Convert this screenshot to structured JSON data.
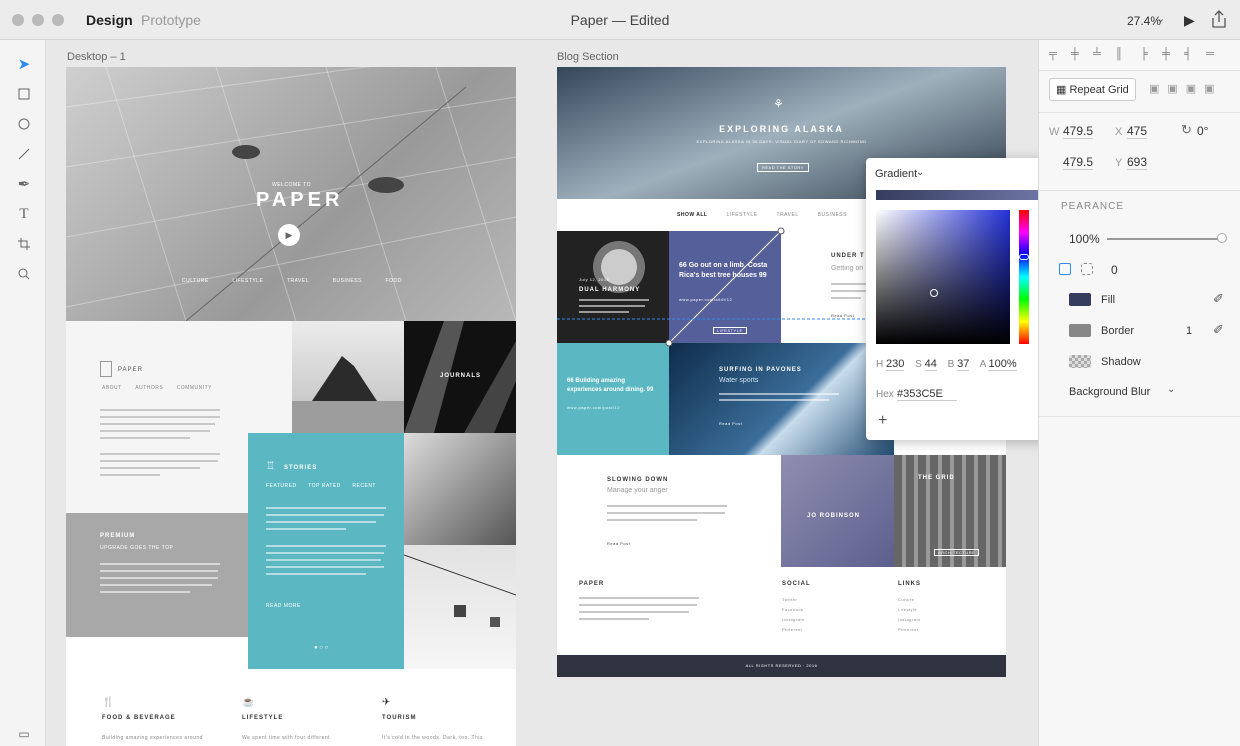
{
  "titlebar": {
    "tab_design": "Design",
    "tab_prototype": "Prototype",
    "doc_title": "Paper — Edited",
    "zoom": "27.4%"
  },
  "artboards": {
    "left": "Desktop – 1",
    "right": "Blog Section"
  },
  "left_art": {
    "hero_small": "WELCOME TO",
    "hero_title": "PAPER",
    "nav": [
      "CULTURE",
      "LIFESTYLE",
      "TRAVEL",
      "BUSINESS",
      "FOOD"
    ],
    "paper_label": "PAPER",
    "paper_tabs": [
      "ABOUT",
      "AUTHORS",
      "COMMUNITY"
    ],
    "journals": "JOURNALS",
    "stories": "STORIES",
    "stories_tabs": [
      "FEATURED",
      "TOP RATED",
      "RECENT"
    ],
    "premium": "PREMIUM",
    "premium_sub": "UPGRADE GOES THE TOP",
    "read_more": "READ MORE",
    "food": "FOOD & BEVERAGE",
    "food_text": "Building amazing experiences around",
    "lifestyle": "LIFESTYLE",
    "lifestyle_text": "We spent time with four different",
    "tourism": "TOURISM",
    "tourism_text": "It's cold in the woods. Dark, too. This"
  },
  "right_art": {
    "hero_title": "EXPLORING ALASKA",
    "hero_sub": "EXPLORING ALASKA IN 30 DAYS: VISUAL DIARY OF EDWARD RICHMOND",
    "hero_btn": "READ THE STORY",
    "filters": [
      "SHOW ALL",
      "LIFESTYLE",
      "TRAVEL",
      "BUSINESS"
    ],
    "dual": "DUAL HARMONY",
    "dual_date": "July 12, 2016",
    "quote1": "66 Go out on a limb. Costa Rica's best tree houses 99",
    "quote1_link": "www.paper.com/a94f/12",
    "under_title": "UNDER T",
    "under_sub": "Getting on",
    "read_post": "Read Post",
    "quote2": "66 Building amazing experiences around dining. 99",
    "quote2_link": "www.paper.com/post/12",
    "surfing": "SURFING IN PAVONES",
    "surfing_sub": "Water sports",
    "slowing": "SLOWING DOWN",
    "slowing_sub": "Manage your anger",
    "jo": "JO ROBINSON",
    "grid": "THE GRID",
    "architecture": "ARCHITECTURE",
    "lifestyle_tag": "LIFESTYLE",
    "footer_paper": "PAPER",
    "footer_social": "SOCIAL",
    "footer_links": "LINKS",
    "social": [
      "Twitter",
      "Facebook",
      "Instagram",
      "Pinterest"
    ],
    "links": [
      "Culture",
      "Lifestyle",
      "Instagram",
      "Pinterest"
    ],
    "copyright": "ALL RIGHTS RESERVED · 2016"
  },
  "picker": {
    "mode": "Gradient",
    "h_label": "H",
    "h": "230",
    "s_label": "S",
    "s": "44",
    "b_label": "B",
    "b": "37",
    "a_label": "A",
    "a": "100%",
    "hex_label": "Hex",
    "hex": "#353C5E",
    "color": "#353C5E"
  },
  "panel": {
    "repeat_grid": "Repeat Grid",
    "w_label": "W",
    "w": "479.5",
    "x_label": "X",
    "x": "475",
    "rotation": "0°",
    "h": "479.5",
    "y_label": "Y",
    "y": "693",
    "appearance": "PEARANCE",
    "opacity": "100%",
    "radius": "0",
    "fill": "Fill",
    "border": "Border",
    "border_width": "1",
    "shadow": "Shadow",
    "background_blur": "Background Blur"
  }
}
